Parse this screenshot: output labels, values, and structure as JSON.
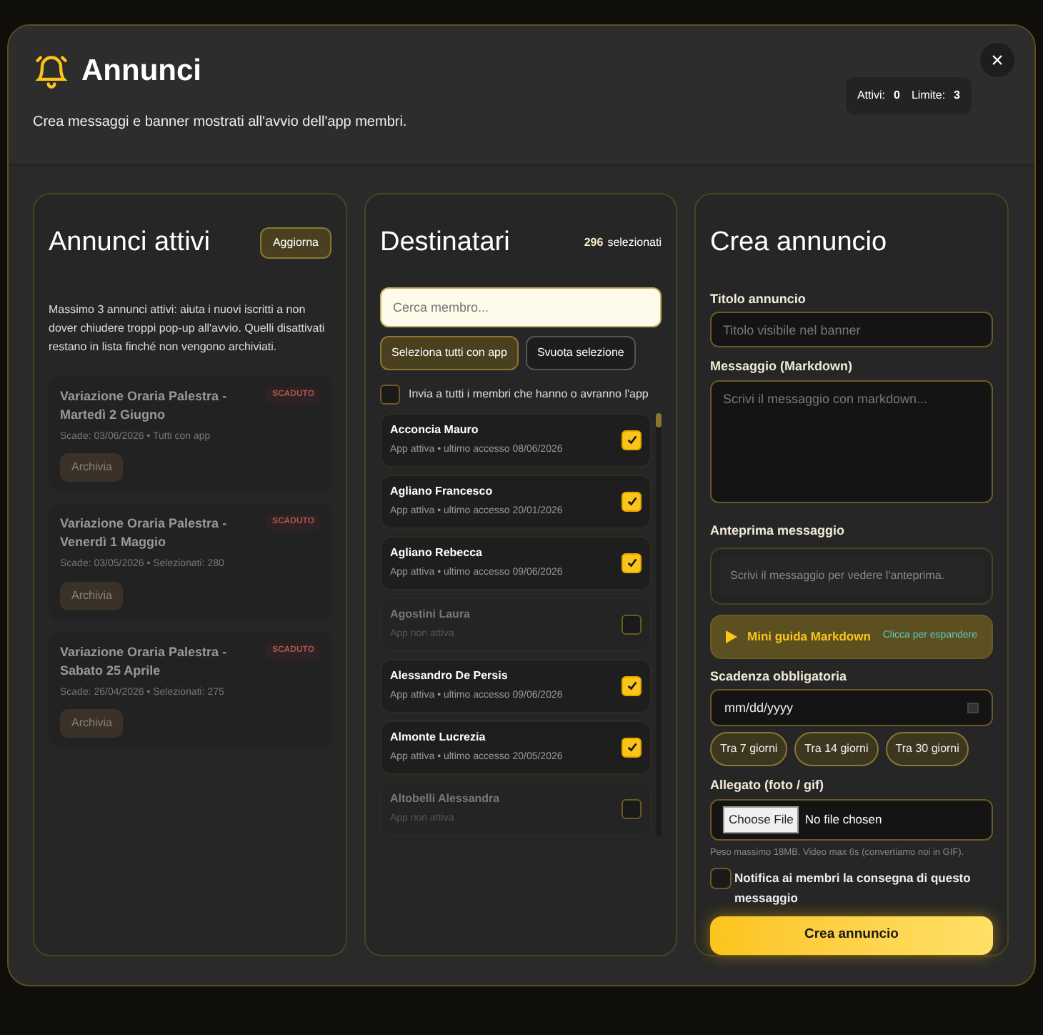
{
  "header": {
    "title": "Annunci",
    "subtitle": "Crea messaggi e banner mostrati all'avvio dell'app membri.",
    "stats": [
      {
        "label": "Attivi:",
        "value": "0"
      },
      {
        "label": "Limite:",
        "value": "3"
      }
    ],
    "close": "×"
  },
  "active": {
    "title": "Annunci attivi",
    "refresh": "Aggiorna",
    "info": "Massimo 3 annunci attivi: aiuta i nuovi iscritti a non dover chiudere troppi pop-up all'avvio. Quelli disattivati restano in lista finché non vengono archiviati.",
    "items": [
      {
        "title": "Variazione Oraria Palestra - Martedì 2 Giugno",
        "badge": "SCADUTO",
        "meta": "Scade: 03/06/2026 • Tutti con app",
        "action": "Archivia"
      },
      {
        "title": "Variazione Oraria Palestra - Venerdì 1 Maggio",
        "badge": "SCADUTO",
        "meta": "Scade: 03/05/2026 • Selezionati: 280",
        "action": "Archivia"
      },
      {
        "title": "Variazione Oraria Palestra - Sabato 25 Aprile",
        "badge": "SCADUTO",
        "meta": "Scade: 26/04/2026 • Selezionati: 275",
        "action": "Archivia"
      }
    ]
  },
  "recipients": {
    "title": "Destinatari",
    "count": "296",
    "count_label": "selezionati",
    "search": {
      "placeholder": "Cerca membro..."
    },
    "select_all": "Seleziona tutti con app",
    "clear": "Svuota selezione",
    "send_all": {
      "label": "Invia a tutti i membri che hanno o avranno l'app",
      "checked": false
    },
    "members": [
      {
        "name": "Acconcia Mauro",
        "status": "App attiva • ultimo accesso 08/06/2026",
        "active": true,
        "checked": true
      },
      {
        "name": "Agliano Francesco",
        "status": "App attiva • ultimo accesso 20/01/2026",
        "active": true,
        "checked": true
      },
      {
        "name": "Agliano Rebecca",
        "status": "App attiva • ultimo accesso 09/06/2026",
        "active": true,
        "checked": true
      },
      {
        "name": "Agostini Laura",
        "status": "App non attiva",
        "active": false,
        "checked": false
      },
      {
        "name": "Alessandro De Persis",
        "status": "App attiva • ultimo accesso 09/06/2026",
        "active": true,
        "checked": true
      },
      {
        "name": "Almonte Lucrezia",
        "status": "App attiva • ultimo accesso 20/05/2026",
        "active": true,
        "checked": true
      },
      {
        "name": "Altobelli Alessandra",
        "status": "App non attiva",
        "active": false,
        "checked": false
      }
    ]
  },
  "create": {
    "title": "Crea annuncio",
    "title_label": "Titolo annuncio",
    "title_field": {
      "placeholder": "Titolo visibile nel banner"
    },
    "message_label": "Messaggio (Markdown)",
    "message_field": {
      "placeholder": "Scrivi il messaggio con markdown..."
    },
    "preview_label": "Anteprima messaggio",
    "preview_text": "Scrivi il messaggio per vedere l'anteprima.",
    "guide": {
      "label": "Mini guida Markdown",
      "hint": "Clicca per espandere",
      "expanded": false
    },
    "deadline_label": "Scadenza obbligatoria",
    "deadline_field": {
      "value": "mm/dd/yyyy"
    },
    "presets": [
      "Tra 7 giorni",
      "Tra 14 giorni",
      "Tra 30 giorni"
    ],
    "attachment_label": "Allegato (foto / gif)",
    "file_button": "Choose File",
    "file_status": "No file chosen",
    "attachment_hint": "Peso massimo 18MB. Video max 6s (convertiamo noi in GIF).",
    "notify": {
      "label": "Notifica ai membri la consegna di questo messaggio",
      "checked": false
    },
    "submit": "Crea annuncio"
  }
}
